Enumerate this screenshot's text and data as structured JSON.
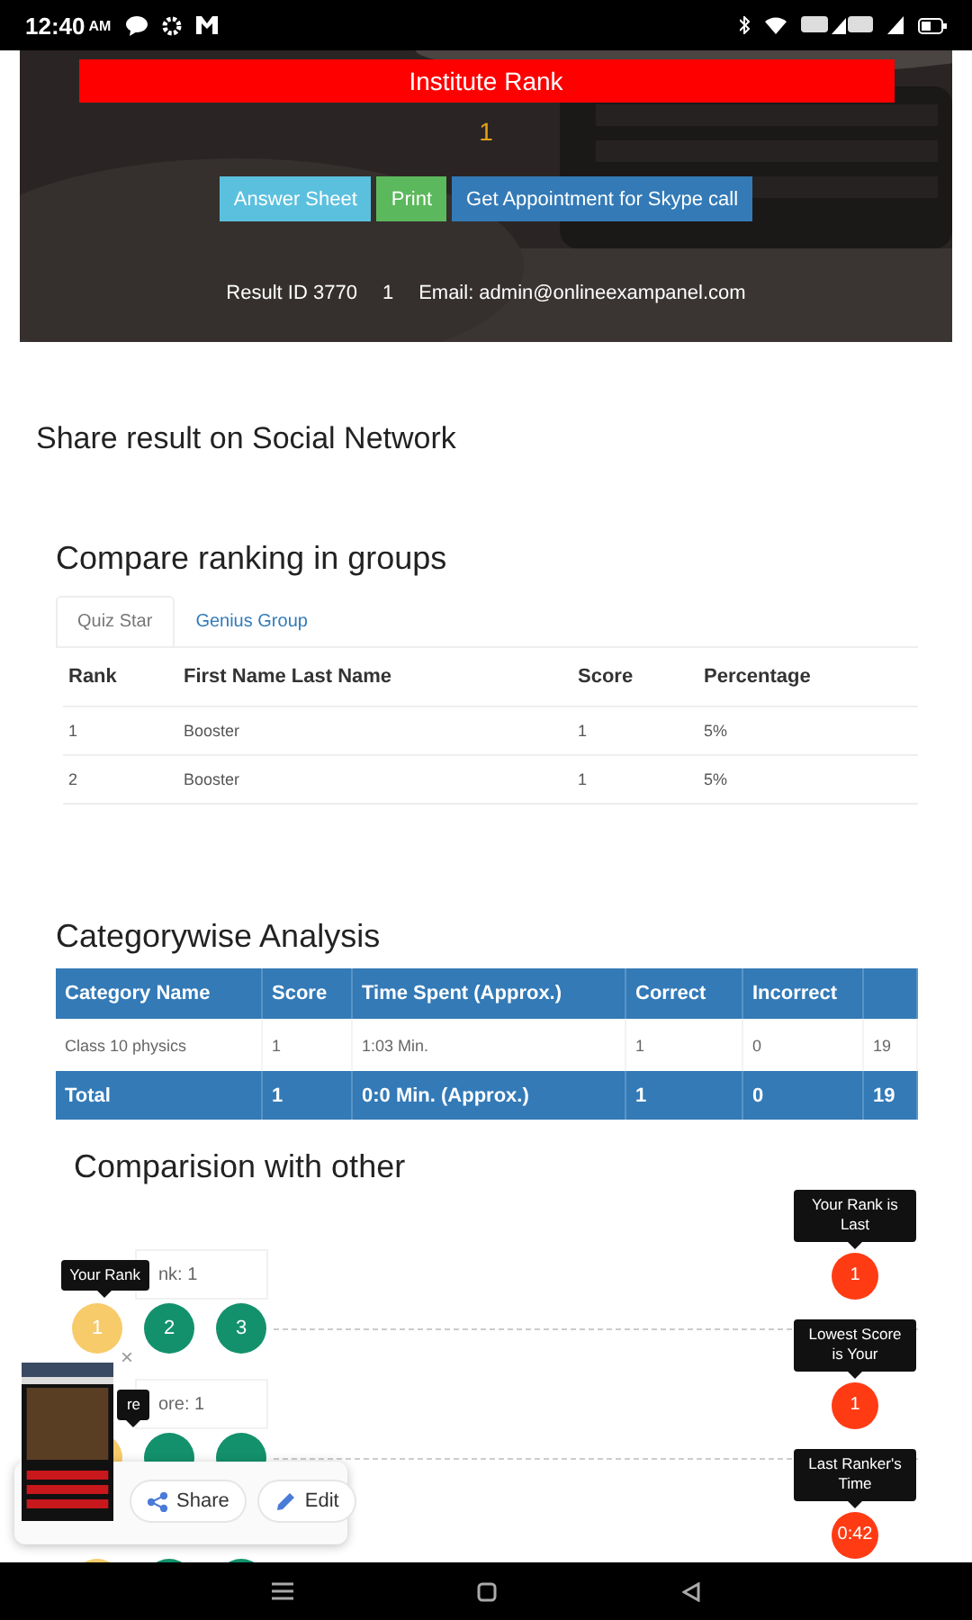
{
  "status_bar": {
    "time": "12:40",
    "ampm": "AM"
  },
  "hero": {
    "rank_title": "Institute Rank",
    "rank_value": "1",
    "buttons": [
      {
        "label": "Answer Sheet",
        "kind": "info"
      },
      {
        "label": "Print",
        "kind": "success"
      },
      {
        "label": "Get Appointment for Skype call",
        "kind": "primary"
      }
    ],
    "result_id": "Result ID 3770",
    "result_number": "1",
    "email": "Email: admin@onlineexampanel.com"
  },
  "share_heading": "Share result on Social Network",
  "groups": {
    "heading": "Compare ranking in groups",
    "tabs": [
      {
        "label": "Quiz Star",
        "selected": true
      },
      {
        "label": "Genius Group",
        "selected": false
      }
    ],
    "columns": [
      "Rank",
      "First Name Last Name",
      "Score",
      "Percentage"
    ],
    "rows": [
      [
        "1",
        "Booster",
        "1",
        "5%"
      ],
      [
        "2",
        "Booster",
        "1",
        "5%"
      ]
    ]
  },
  "category": {
    "heading": "Categorywise Analysis",
    "columns": [
      "Category Name",
      "Score",
      "Time Spent (Approx.)",
      "Correct",
      "Incorrect"
    ],
    "rows": [
      [
        "Class 10 physics",
        "1",
        "1:03 Min.",
        "1",
        "0",
        "19"
      ]
    ],
    "total": [
      "Total",
      "1",
      "0:0 Min. (Approx.)",
      "1",
      "0",
      "19"
    ]
  },
  "comparison": {
    "heading": "Comparision with other",
    "rows": [
      {
        "label": "nk: 1",
        "tooltip": "Your Rank",
        "circles": [
          {
            "text": "1",
            "kind": "you"
          },
          {
            "text": "2",
            "kind": "other"
          },
          {
            "text": "3",
            "kind": "other"
          }
        ],
        "last_tooltip": "Your Rank is Last",
        "last_value": "1"
      },
      {
        "label": "ore: 1",
        "tooltip": "re",
        "circles": [
          {
            "kind": "you"
          },
          {
            "kind": "other"
          },
          {
            "kind": "other"
          }
        ],
        "last_tooltip": "Lowest Score is Your",
        "last_value": "1"
      },
      {
        "circles": [
          {
            "kind": "you"
          },
          {
            "kind": "other"
          },
          {
            "kind": "other"
          }
        ],
        "last_tooltip": "Last Ranker's Time",
        "last_value": "0:42"
      }
    ]
  },
  "screenshot_popup": {
    "close": "×",
    "actions": [
      {
        "label": "Share",
        "kind": "share"
      },
      {
        "label": "Edit",
        "kind": "edit"
      }
    ]
  }
}
